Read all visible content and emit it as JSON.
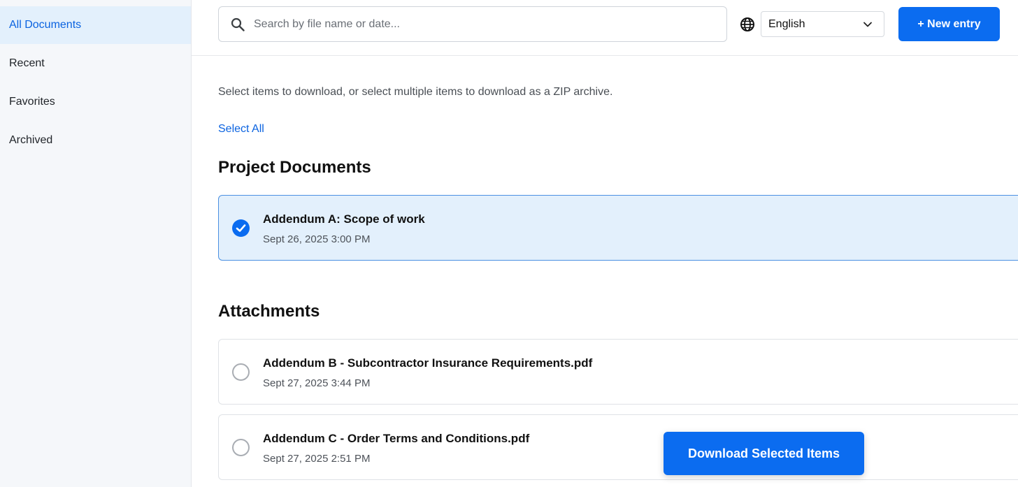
{
  "sidebar": {
    "items": [
      {
        "label": "All Documents",
        "active": true
      },
      {
        "label": "Recent",
        "active": false
      },
      {
        "label": "Favorites",
        "active": false
      },
      {
        "label": "Archived",
        "active": false
      }
    ]
  },
  "header": {
    "search_placeholder": "Search by file name or date...",
    "search_icon": "search-icon",
    "globe_icon": "globe-icon",
    "language": "English",
    "new_entry_label": "+ New entry"
  },
  "main": {
    "description": "Select items to download, or select multiple items to download as a ZIP archive.",
    "select_all_label": "Select All",
    "sections": [
      {
        "title": "Project Documents",
        "items": [
          {
            "title": "Addendum A: Scope of work",
            "date": "Sept 26, 2025 3:00 PM",
            "selected": true
          }
        ]
      },
      {
        "title": "Attachments",
        "items": [
          {
            "title": "Addendum B - Subcontractor Insurance Requirements.pdf",
            "date": "Sept 27, 2025 3:44 PM",
            "selected": false
          },
          {
            "title": "Addendum C - Order Terms and Conditions.pdf",
            "date": "Sept 27, 2025 2:51 PM",
            "selected": false
          }
        ]
      }
    ],
    "download_label": "Download Selected Items"
  },
  "colors": {
    "accent": "#0b6cf0",
    "selected_bg": "#e3f0fc",
    "sidebar_bg": "#f5f7fa"
  }
}
